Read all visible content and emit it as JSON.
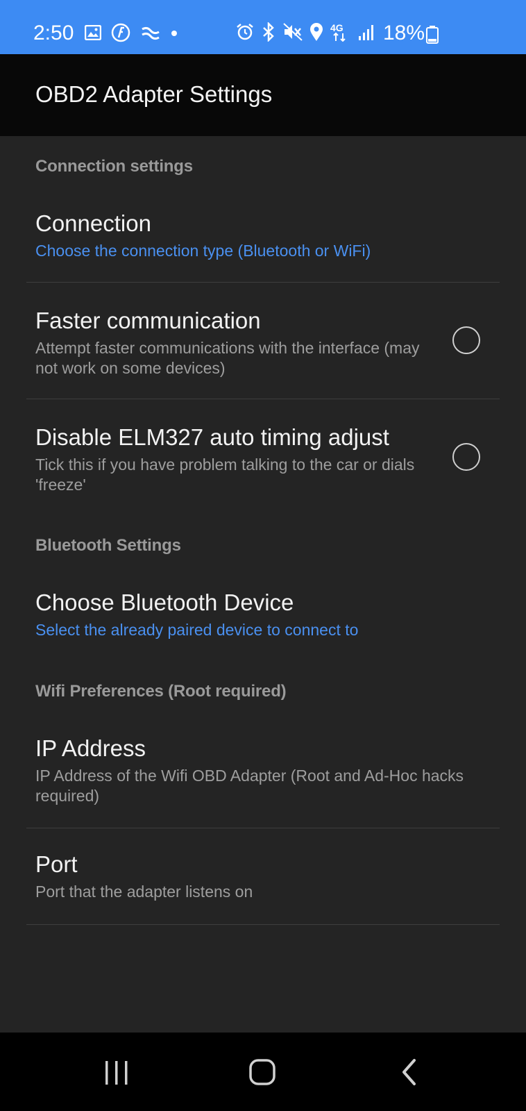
{
  "status_bar": {
    "time": "2:50",
    "battery_percent": "18%",
    "network_label": "4G",
    "background_color": "#3d8bf3",
    "left_icons": [
      "image-icon",
      "app-icon",
      "app-icon-2",
      "dot-icon"
    ],
    "right_icons": [
      "alarm-icon",
      "bluetooth-icon",
      "mute-icon",
      "location-icon",
      "network-4g-icon",
      "signal-icon",
      "battery-icon"
    ]
  },
  "app_bar": {
    "title": "OBD2 Adapter Settings"
  },
  "sections": [
    {
      "header": "Connection settings",
      "items": [
        {
          "title": "Connection",
          "summary": "Choose the connection type (Bluetooth or WiFi)",
          "summary_style": "link",
          "checked": null
        },
        {
          "title": "Faster communication",
          "summary": "Attempt faster communications with the interface (may not work on some devices)",
          "summary_style": "normal",
          "checked": false
        },
        {
          "title": "Disable ELM327 auto timing adjust",
          "summary": "Tick this if you have problem talking to the car or dials 'freeze'",
          "summary_style": "normal",
          "checked": false
        }
      ]
    },
    {
      "header": "Bluetooth Settings",
      "items": [
        {
          "title": "Choose Bluetooth Device",
          "summary": "Select the already paired device to connect to",
          "summary_style": "link",
          "checked": null
        }
      ]
    },
    {
      "header": "Wifi Preferences (Root required)",
      "items": [
        {
          "title": "IP Address",
          "summary": "IP Address of the Wifi OBD Adapter (Root and Ad-Hoc hacks required)",
          "summary_style": "normal",
          "checked": null
        },
        {
          "title": "Port",
          "summary": "Port that the adapter listens on",
          "summary_style": "normal",
          "checked": null
        }
      ]
    }
  ],
  "nav_bar": {
    "buttons": [
      "recent-apps-icon",
      "home-icon",
      "back-icon"
    ]
  },
  "colors": {
    "accent": "#4a90f0",
    "background": "#242424",
    "app_bar": "#080808",
    "category_text": "#9a9a9a",
    "summary_text": "#9e9e9e"
  }
}
